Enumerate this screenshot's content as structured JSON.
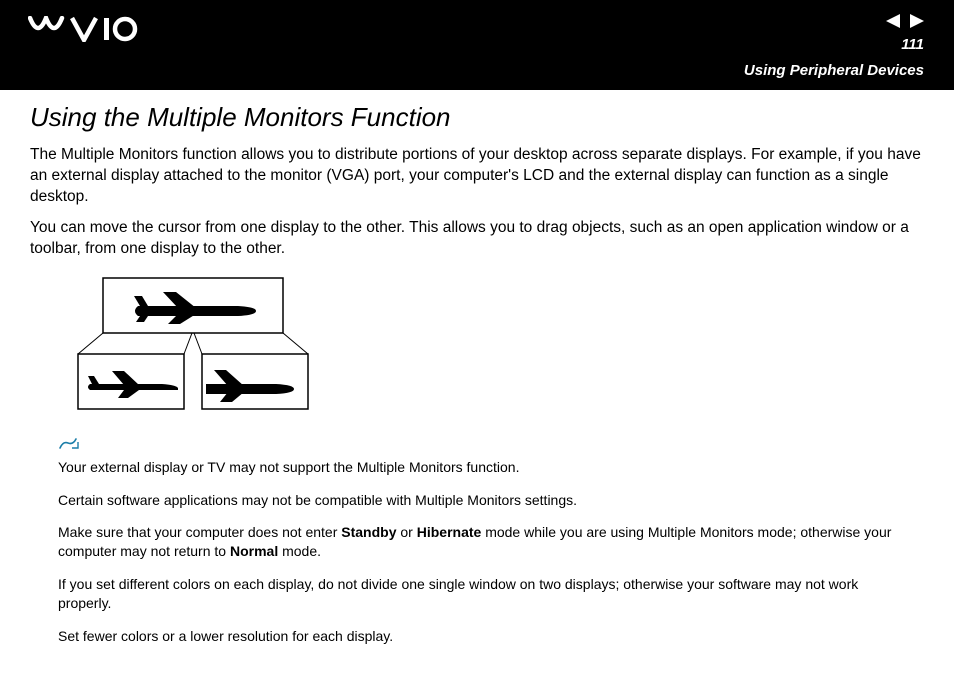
{
  "header": {
    "page_number": "111",
    "section": "Using Peripheral Devices"
  },
  "content": {
    "title": "Using the Multiple Monitors Function",
    "para1": "The Multiple Monitors function allows you to distribute portions of your desktop across separate displays. For example, if you have an external display attached to the monitor (VGA) port, your computer's LCD and the external display can function as a single desktop.",
    "para2": "You can move the cursor from one display to the other. This allows you to drag objects, such as an open application window or a toolbar, from one display to the other."
  },
  "notes": {
    "n1": "Your external display or TV may not support the Multiple Monitors function.",
    "n2": "Certain software applications may not be compatible with Multiple Monitors settings.",
    "n3_pre": "Make sure that your computer does not enter ",
    "n3_bold1": "Standby",
    "n3_mid1": " or ",
    "n3_bold2": "Hibernate",
    "n3_mid2": " mode while you are using Multiple Monitors mode; otherwise your computer may not return to ",
    "n3_bold3": "Normal",
    "n3_post": " mode.",
    "n4": "If you set different colors on each display, do not divide one single window on two displays; otherwise your software may not work properly.",
    "n5": "Set fewer colors or a lower resolution for each display."
  }
}
